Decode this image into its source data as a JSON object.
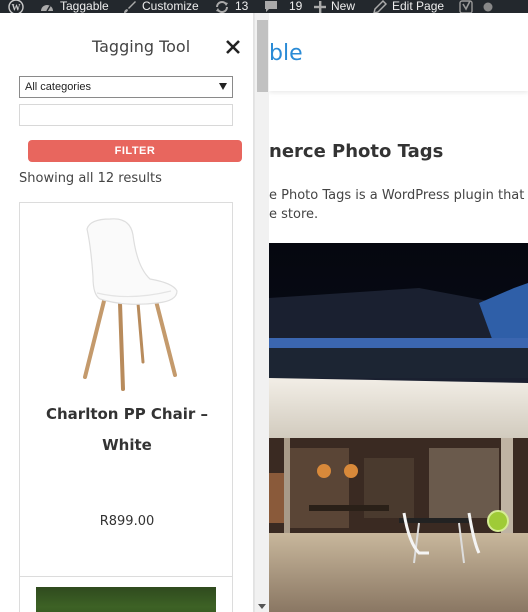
{
  "adminbar": {
    "site_name": "Taggable",
    "customize": "Customize",
    "updates_count": "13",
    "comments_count": "19",
    "new_label": "New",
    "edit_page": "Edit Page"
  },
  "panel": {
    "title": "Tagging Tool",
    "category_select": "All categories",
    "search_placeholder": "",
    "filter_label": "FILTER",
    "results_count": "Showing all 12 results",
    "products": [
      {
        "name": "Charlton PP Chair –",
        "name_line2": "White",
        "price": "R899.00"
      }
    ]
  },
  "main": {
    "logo_fragment": "ble",
    "post_title": "nerce Photo Tags",
    "post_text_line1": "e Photo Tags is a WordPress plugin that a",
    "post_text_line2": "e store."
  },
  "colors": {
    "adminbar_bg": "#23282d",
    "filter_button": "#e8665e",
    "logo_blue": "#2a8bd6",
    "hotspot": "#9fcb37"
  }
}
